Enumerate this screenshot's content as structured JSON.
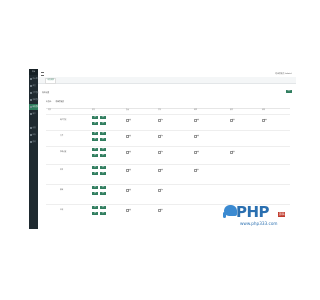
{
  "sidebar": {
    "logo": "后台",
    "items": [
      {
        "label": "后台首页"
      },
      {
        "label": "会员"
      },
      {
        "label": "文章管理"
      },
      {
        "label": "系统管理"
      },
      {
        "label": "角色管理"
      },
      {
        "label": "用户"
      },
      {
        "label": "设置"
      },
      {
        "label": "日志"
      },
      {
        "label": "其他"
      }
    ],
    "active_index": 4
  },
  "topbar": {
    "user": "超级管理员 (admin)"
  },
  "tab": {
    "label": "角色权限"
  },
  "page": {
    "section_title": "权限设置",
    "save_label": "保存",
    "role_label": "角色名:",
    "role_value": "超级管理员"
  },
  "grid": {
    "headers": [
      "权限",
      "模块",
      "查看",
      "添加",
      "编辑",
      "删除",
      "审核",
      "导出"
    ],
    "rows": [
      {
        "name": "用户管理",
        "buttons": [
          "全选",
          "反选"
        ],
        "checks": [
          "查看",
          "添加",
          "编辑",
          "删除",
          "审核"
        ]
      },
      {
        "name": "文章",
        "buttons": [
          "全选",
          "反选"
        ],
        "checks": [
          "查看",
          "添加",
          "编辑"
        ]
      },
      {
        "name": "系统设置",
        "buttons": [
          "全选",
          "反选"
        ],
        "checks": [
          "查看",
          "添加",
          "编辑",
          "删除"
        ]
      },
      {
        "name": "栏目",
        "buttons": [
          "全选",
          "反选"
        ],
        "checks": [
          "查看",
          "编辑",
          "删除"
        ]
      },
      {
        "name": "模板",
        "buttons": [
          "全选",
          "反选"
        ],
        "checks": [
          "查看",
          "添加"
        ]
      },
      {
        "name": "日志",
        "buttons": [
          "全选",
          "反选"
        ],
        "checks": [
          "查看",
          "删除"
        ]
      }
    ]
  },
  "watermark": {
    "brand": "PHP",
    "badge": "源码",
    "url": "www.php333.com"
  }
}
